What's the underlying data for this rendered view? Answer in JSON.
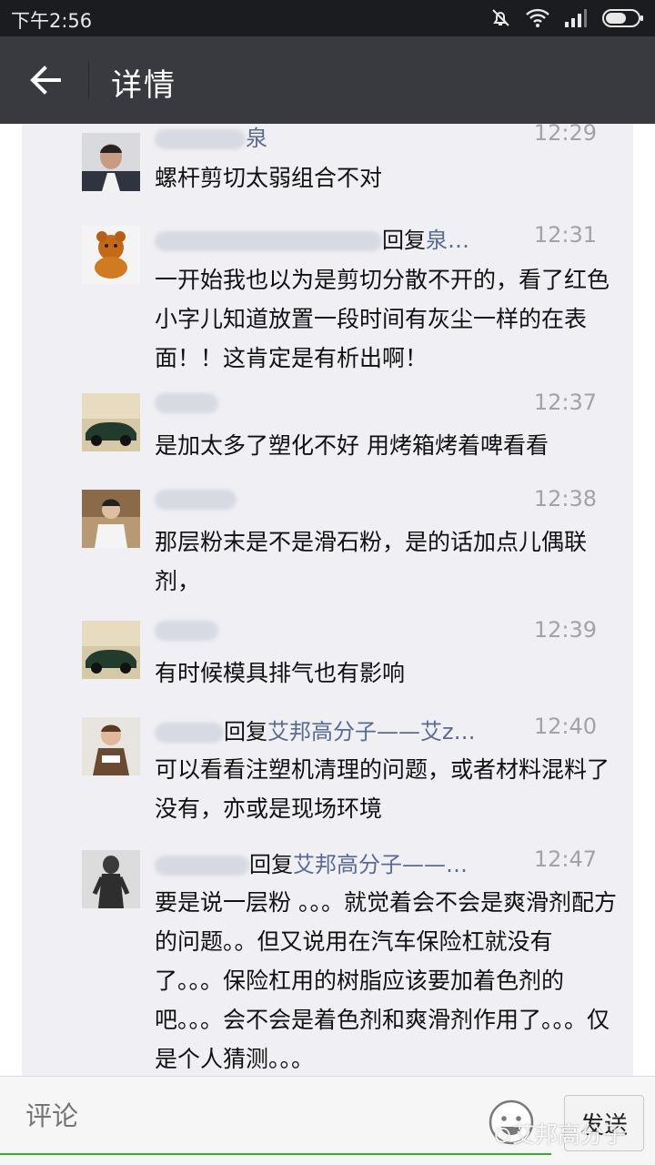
{
  "status_bar": {
    "time": "下午2:56",
    "icons": [
      "mute-icon",
      "wifi-icon",
      "signal-icon",
      "battery-icon"
    ]
  },
  "header": {
    "title": "详情",
    "back_icon": "back-arrow-icon"
  },
  "comments": [
    {
      "name": "泉",
      "reply_prefix": "",
      "reply_to": "",
      "time": "12:29",
      "text": "螺杆剪切太弱组合不对"
    },
    {
      "name": "",
      "reply_prefix": "回复",
      "reply_to": "泉…",
      "time": "12:31",
      "text": "一开始我也以为是剪切分散不开的，看了红色小字儿知道放置一段时间有灰尘一样的在表面！！这肯定是有析出啊！"
    },
    {
      "name": "",
      "reply_prefix": "",
      "reply_to": "",
      "time": "12:37",
      "text": "是加太多了塑化不好 用烤箱烤着啤看看"
    },
    {
      "name": "",
      "reply_prefix": "",
      "reply_to": "",
      "time": "12:38",
      "text": "那层粉末是不是滑石粉，是的话加点儿偶联剂，"
    },
    {
      "name": "",
      "reply_prefix": "",
      "reply_to": "",
      "time": "12:39",
      "text": "有时候模具排气也有影响"
    },
    {
      "name": "",
      "reply_prefix": "回复",
      "reply_to": "艾邦高分子——艾z…",
      "time": "12:40",
      "text": "可以看看注塑机清理的问题，或者材料混料了没有，亦或是现场环境"
    },
    {
      "name": "",
      "reply_prefix": "回复",
      "reply_to": "艾邦高分子——…",
      "time": "12:47",
      "text": "要是说一层粉 。。。就觉着会不会是爽滑剂配方的问题。。但又说用在汽车保险杠就没有了。。。保险杠用的树脂应该要加着色剂的吧。。。会不会是着色剂和爽滑剂作用了。。。仅是个人猜测。。。"
    }
  ],
  "bottom_bar": {
    "placeholder": "评论",
    "send_label": "发送",
    "emoji_icon": "emoji-icon",
    "watermark": "艾邦高分子"
  },
  "colors": {
    "status_bar_bg": "#1b1c1f",
    "title_bar_bg": "#393a3f",
    "card_bg": "#f0eff4",
    "name_link": "#5a6b92",
    "timestamp": "#a3a3a7",
    "input_underline": "#2cb52c"
  }
}
